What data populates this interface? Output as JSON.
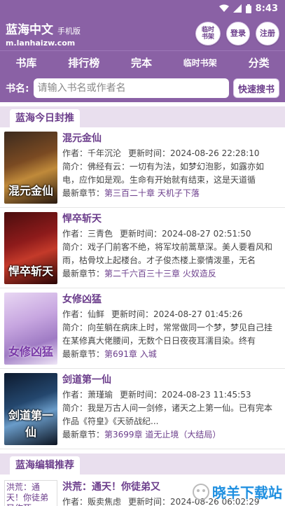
{
  "status": {
    "time": "8:43"
  },
  "header": {
    "site_name": "蓝海中文",
    "site_sub": "手机版",
    "domain": "m.lanhaizw.com",
    "buttons": {
      "temp_shelf": "临时书架",
      "login": "登录",
      "register": "注册"
    }
  },
  "nav": {
    "items": [
      "书库",
      "排行榜",
      "完本",
      "临时书架",
      "分类"
    ]
  },
  "search": {
    "label": "书名:",
    "placeholder": "请输入书名或作者名",
    "button": "快速搜书"
  },
  "sections": {
    "today": "蓝海今日封推",
    "editor": "蓝海编辑推荐"
  },
  "labels": {
    "author": "作者：",
    "updated": "更新时间：",
    "intro": "简介：",
    "latest": "最新章节："
  },
  "books": [
    {
      "title": "混元金仙",
      "author": "千年沉沦",
      "updated": "2024-08-26 22:28:10",
      "intro": "佛经有云：一切有为法，如梦幻泡影，如露亦如电，应作如是观。生命有开始就有结束，这是天道循",
      "latest": "第三百二十章 天机子下落",
      "cover_text": "混元金仙"
    },
    {
      "title": "悍卒斩天",
      "author": "三青色",
      "updated": "2024-08-27 02:51:50",
      "intro": "戏子门前客不绝，将军坟前蒿草深。美人要看风和雨，枯骨坟上起楼台。才子俊杰楼上豪情泼墨，无名",
      "latest": "第二千六百三十三章 火奴造反",
      "cover_text": "悍卒斩天"
    },
    {
      "title": "女修凶猛",
      "author": "仙鲜",
      "updated": "2024-08-27 01:45:26",
      "intro": "向苼躺在病床上时，常常做同一个梦，梦见自己挂在某修真大佬腰间，无数个日日夜夜耳濡目染。终有",
      "latest": "第691章 入城",
      "cover_text": "女修凶猛"
    },
    {
      "title": "剑道第一仙",
      "author": "萧瑾瑜",
      "updated": "2024-08-23 11:45:53",
      "intro": "我是万古人间一剑修，诸天之上第一仙。已有完本作品《符皇》《天骄战纪...",
      "latest": "第3699章 道无止境（大结局）",
      "cover_text": "剑道第一仙"
    }
  ],
  "editor_book": {
    "cover_alt": "洪荒：通天！你徒弟又作死",
    "title": "洪荒：通天！你徒弟又",
    "author": "贩卖焦虑",
    "updated": "2024-08-26 06:02:29"
  },
  "watermark": {
    "text": "晓羊下载站"
  },
  "colors": {
    "primary": "#8a61a5",
    "accent": "#6b3d8b",
    "section_bg": "#e9dfee"
  }
}
